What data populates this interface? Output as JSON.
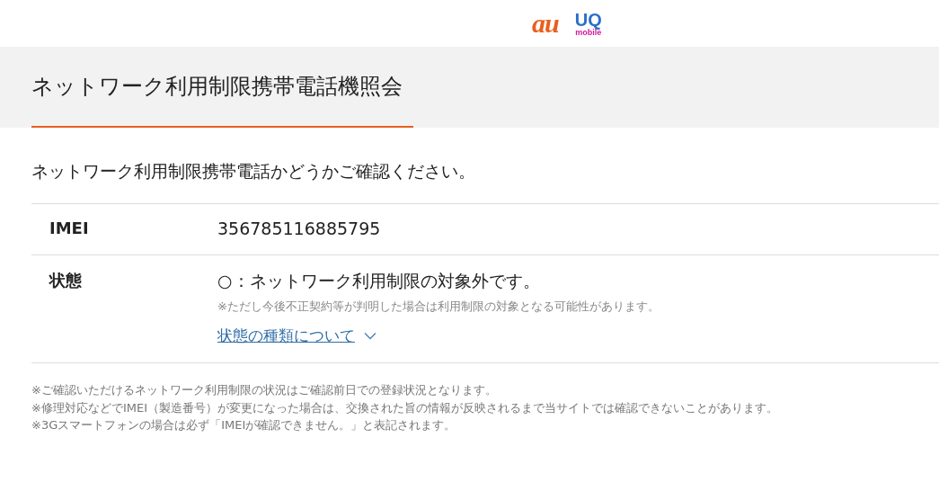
{
  "header": {
    "logos": [
      {
        "kind": "au",
        "text": "au"
      },
      {
        "kind": "uq",
        "text": "UQ",
        "subtext": "mobile"
      }
    ]
  },
  "page_title": "ネットワーク利用制限携帯電話機照会",
  "intro": "ネットワーク利用制限携帯電話かどうかご確認ください。",
  "result_table": {
    "rows": [
      {
        "label": "IMEI",
        "value": "356785116885795"
      },
      {
        "label": "状態",
        "value": "○：ネットワーク利用制限の対象外です。",
        "note": "※ただし今後不正契約等が判明した場合は利用制限の対象となる可能性があります。",
        "link": {
          "text": "状態の種類について",
          "expanded": false
        }
      }
    ]
  },
  "notes": [
    "※ご確認いただけるネットワーク利用制限の状況はご確認前日での登録状況となります。",
    "※修理対応などでIMEI（製造番号）が変更になった場合は、交換された旨の情報が反映されるまで当サイトでは確認できないことがあります。",
    "※3Gスマートフォンの場合は必ず「IMEIが確認できません。」と表記されます。"
  ]
}
